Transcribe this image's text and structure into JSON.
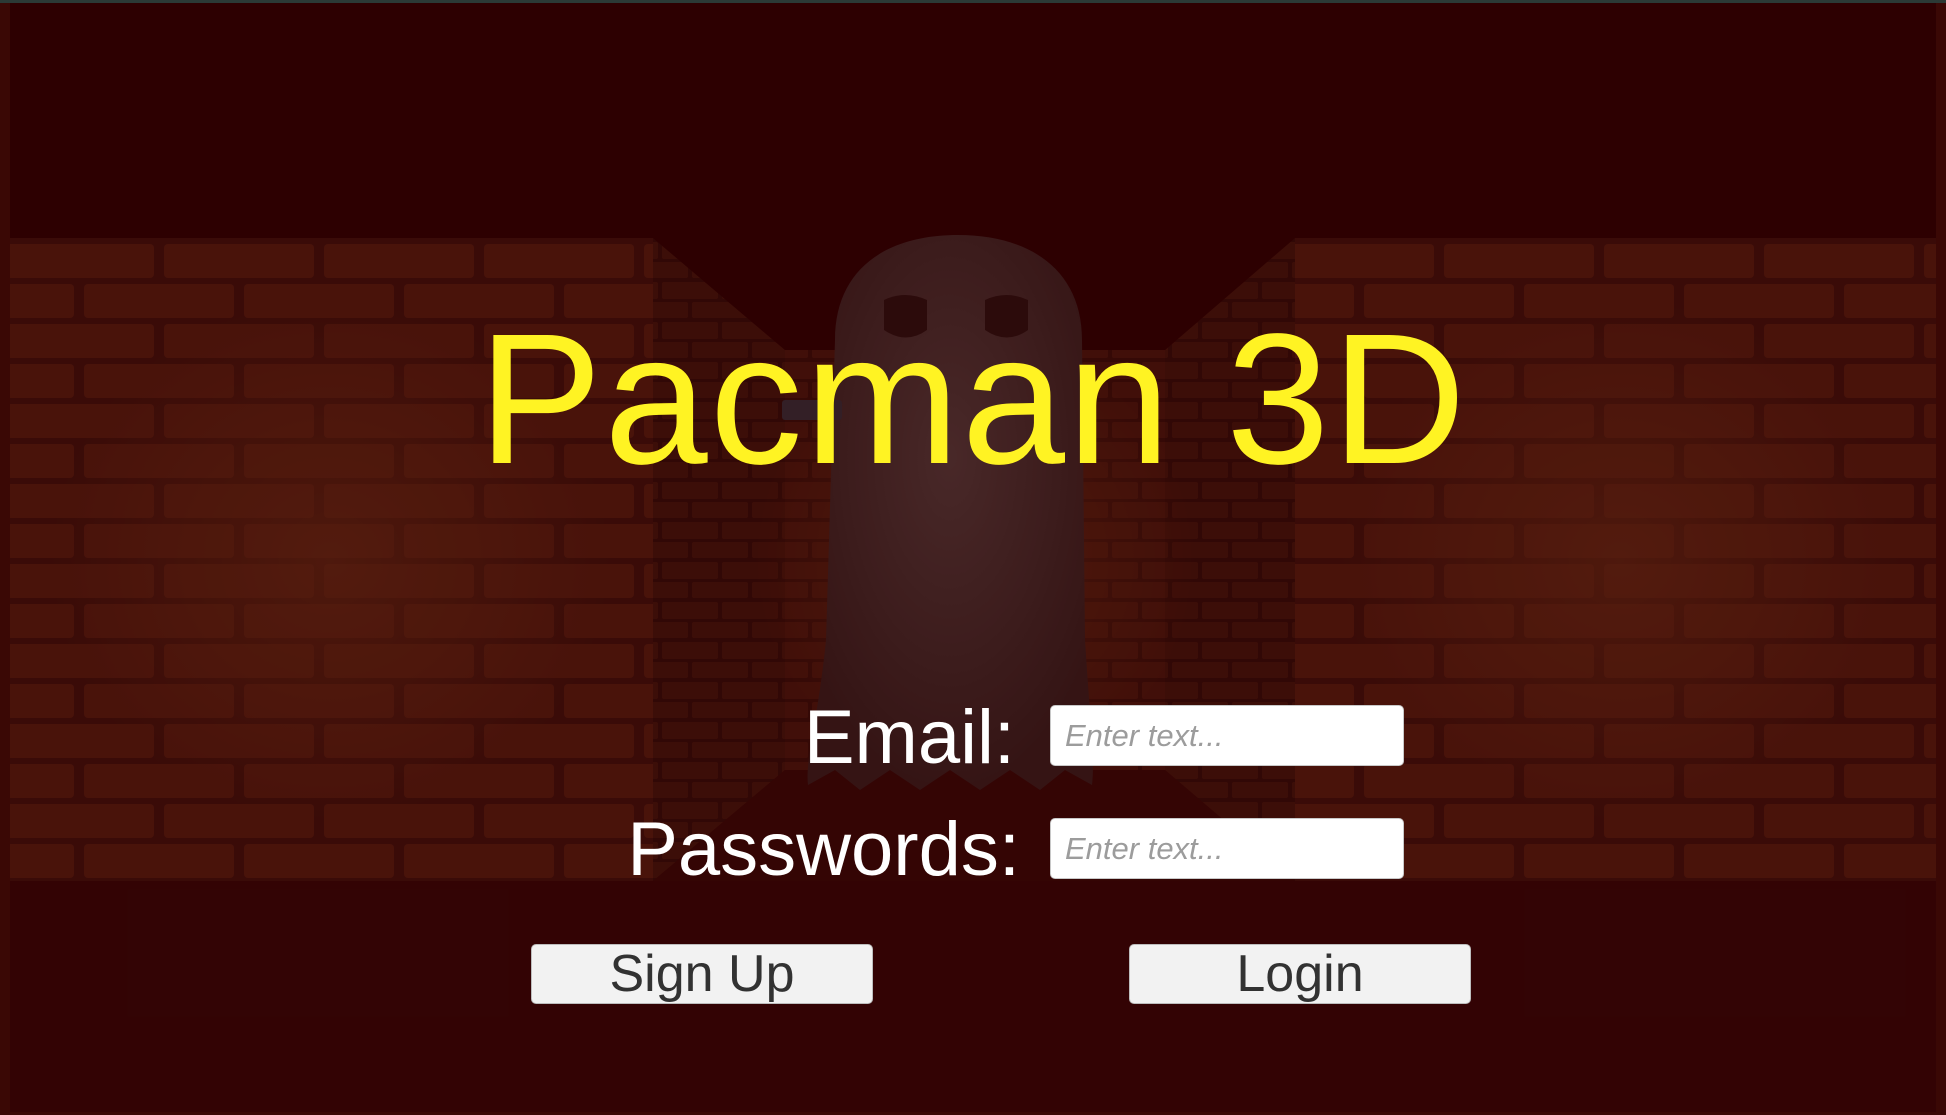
{
  "game": {
    "title": "Pacman 3D",
    "title_color": "#FFF323",
    "background_colors": {
      "sky": "#2E0002",
      "brick": "#6B2A14",
      "floor": "#3A0A08",
      "ghost": "#5A4A48"
    }
  },
  "form": {
    "email_label": "Email:",
    "email_placeholder": "Enter text...",
    "password_label": "Passwords:",
    "password_placeholder": "Enter text..."
  },
  "buttons": {
    "signup_label": "Sign Up",
    "login_label": "Login"
  }
}
